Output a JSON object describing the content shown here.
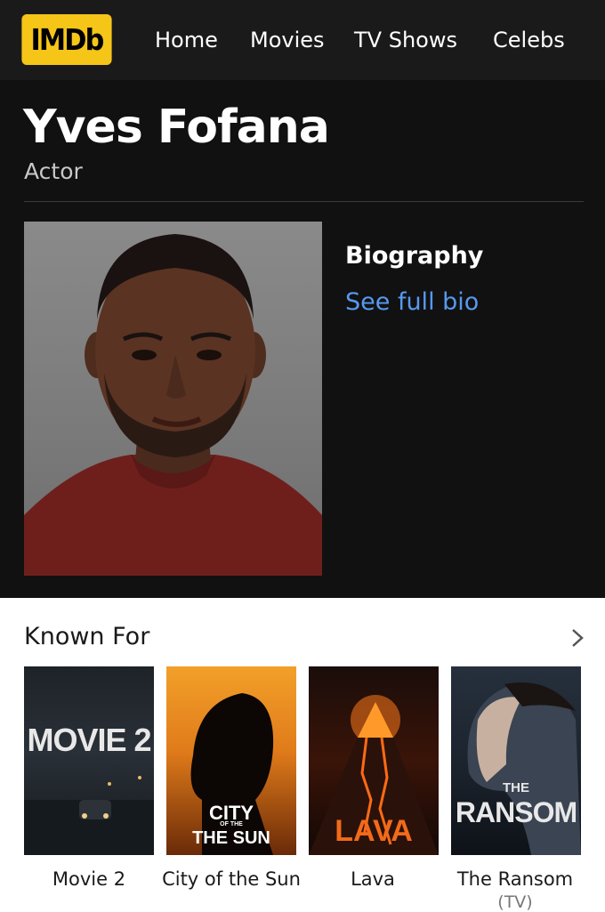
{
  "header": {
    "logo": "IMDb",
    "nav": [
      "Home",
      "Movies",
      "TV Shows",
      "Celebs"
    ]
  },
  "person": {
    "name": "Yves Fofana",
    "role": "Actor",
    "bio_title": "Biography",
    "bio_link": "See full bio"
  },
  "known_for": {
    "title": "Known For",
    "items": [
      {
        "poster_title": "MOVIE 2",
        "caption": "Movie 2"
      },
      {
        "poster_title_line1": "CITY",
        "poster_title_small": "OF THE",
        "poster_title_line2": "THE SUN",
        "caption": "City of the Sun"
      },
      {
        "poster_title": "LAVA",
        "caption": "Lava"
      },
      {
        "poster_title_small": "THE",
        "poster_title": "RANSOM",
        "caption": "The Ransom",
        "subcaption": "(TV)"
      }
    ]
  },
  "colors": {
    "logo_bg": "#f5c518",
    "link": "#5799ef",
    "header_bg": "#1a1a1a",
    "hero_bg": "#111111"
  },
  "icons": {
    "chevron": "chevron-right-icon"
  }
}
